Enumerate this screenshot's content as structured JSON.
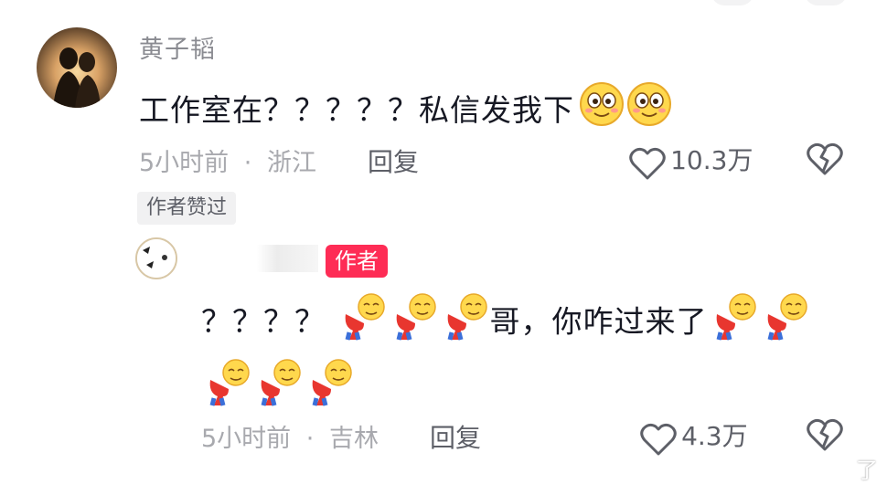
{
  "comment": {
    "username": "黄子韬",
    "text": "工作室在？？？？？私信发我下",
    "emoji_count": 2,
    "time": "5小时前",
    "location": "浙江",
    "separator": "·",
    "reply_label": "回复",
    "likes": "10.3万",
    "liked_badge": "作者赞过"
  },
  "reply": {
    "author_badge": "作者",
    "text_prefix": "？？？？",
    "text_middle": "哥，你咋过来了",
    "time": "5小时前",
    "location": "吉林",
    "separator": "·",
    "reply_label": "回复",
    "likes": "4.3万"
  },
  "watermark": "了",
  "colors": {
    "author_badge": "#fe2c55",
    "meta_gray": "#a8a9ae",
    "text_dark": "#161823"
  },
  "icons": [
    "heart-outline-icon",
    "broken-heart-icon",
    "smile-emoji-icon",
    "bowing-emoji-icon"
  ]
}
